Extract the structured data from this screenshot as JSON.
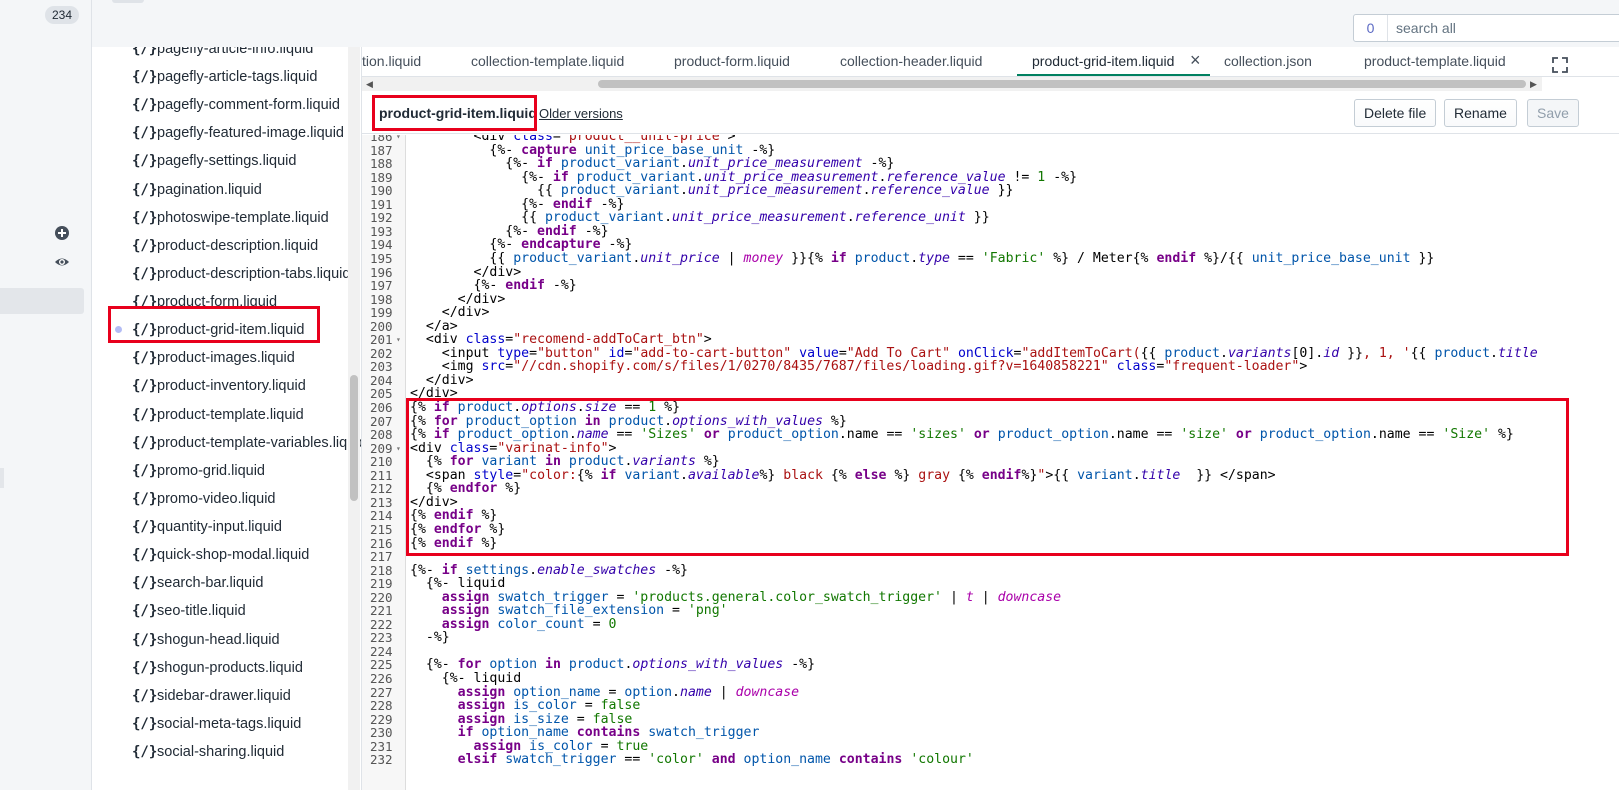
{
  "nav": {
    "badge": "234"
  },
  "search": {
    "count": "0",
    "placeholder": "search all"
  },
  "files": [
    {
      "icon": "{/}",
      "name": "pagefly-article-info.liquid"
    },
    {
      "icon": "{/}",
      "name": "pagefly-article-tags.liquid"
    },
    {
      "icon": "{/}",
      "name": "pagefly-comment-form.liquid"
    },
    {
      "icon": "{/}",
      "name": "pagefly-featured-image.liquid"
    },
    {
      "icon": "{/}",
      "name": "pagefly-settings.liquid"
    },
    {
      "icon": "{/}",
      "name": "pagination.liquid"
    },
    {
      "icon": "{/}",
      "name": "photoswipe-template.liquid"
    },
    {
      "icon": "{/}",
      "name": "product-description.liquid"
    },
    {
      "icon": "{/}",
      "name": "product-description-tabs.liquid"
    },
    {
      "icon": "{/}",
      "name": "product-form.liquid"
    },
    {
      "icon": "{/}",
      "name": "product-grid-item.liquid"
    },
    {
      "icon": "{/}",
      "name": "product-images.liquid"
    },
    {
      "icon": "{/}",
      "name": "product-inventory.liquid"
    },
    {
      "icon": "{/}",
      "name": "product-template.liquid"
    },
    {
      "icon": "{/}",
      "name": "product-template-variables.liquid"
    },
    {
      "icon": "{/}",
      "name": "promo-grid.liquid"
    },
    {
      "icon": "{/}",
      "name": "promo-video.liquid"
    },
    {
      "icon": "{/}",
      "name": "quantity-input.liquid"
    },
    {
      "icon": "{/}",
      "name": "quick-shop-modal.liquid"
    },
    {
      "icon": "{/}",
      "name": "search-bar.liquid"
    },
    {
      "icon": "{/}",
      "name": "seo-title.liquid"
    },
    {
      "icon": "{/}",
      "name": "shogun-head.liquid"
    },
    {
      "icon": "{/}",
      "name": "shogun-products.liquid"
    },
    {
      "icon": "{/}",
      "name": "sidebar-drawer.liquid"
    },
    {
      "icon": "{/}",
      "name": "social-meta-tags.liquid"
    },
    {
      "icon": "{/}",
      "name": "social-sharing.liquid"
    }
  ],
  "tabs": [
    {
      "label": "tion.liquid"
    },
    {
      "label": "collection-template.liquid"
    },
    {
      "label": "product-form.liquid"
    },
    {
      "label": "collection-header.liquid"
    },
    {
      "label": "product-grid-item.liquid"
    },
    {
      "label": "collection.json"
    },
    {
      "label": "product-template.liquid"
    }
  ],
  "tab_close": "×",
  "editor": {
    "filename": "product-grid-item.liquid",
    "older_versions": "Older versions",
    "delete_label": "Delete file",
    "rename_label": "Rename",
    "save_label": "Save"
  },
  "code_lines": [
    {
      "n": "186",
      "fold": "▾",
      "html": "        &lt;div <span class=\"a\">class</span>=<span class=\"s\">\"product__unit-price\"</span>&gt;"
    },
    {
      "n": "187",
      "fold": "",
      "html": "          {%- <span class=\"k\">capture</span> <span class=\"v\">unit_price_base_unit</span> -%}"
    },
    {
      "n": "188",
      "fold": "",
      "html": "            {%- <span class=\"k\">if</span> <span class=\"v\">product_variant</span>.<span class=\"f\">unit_price_measurement</span> -%}"
    },
    {
      "n": "189",
      "fold": "",
      "html": "              {%- <span class=\"k\">if</span> <span class=\"v\">product_variant</span>.<span class=\"f\">unit_price_measurement</span>.<span class=\"f\">reference_value</span> != <span class=\"t\">1</span> -%}"
    },
    {
      "n": "190",
      "fold": "",
      "html": "                {{ <span class=\"v\">product_variant</span>.<span class=\"f\">unit_price_measurement</span>.<span class=\"f\">reference_value</span> }}"
    },
    {
      "n": "191",
      "fold": "",
      "html": "              {%- <span class=\"k\">endif</span> -%}"
    },
    {
      "n": "192",
      "fold": "",
      "html": "              {{ <span class=\"v\">product_variant</span>.<span class=\"f\">unit_price_measurement</span>.<span class=\"f\">reference_unit</span> }}"
    },
    {
      "n": "193",
      "fold": "",
      "html": "            {%- <span class=\"k\">endif</span> -%}"
    },
    {
      "n": "194",
      "fold": "",
      "html": "          {%- <span class=\"k\">endcapture</span> -%}"
    },
    {
      "n": "195",
      "fold": "",
      "html": "          {{ <span class=\"v\">product_variant</span>.<span class=\"f\">unit_price</span> | <span class=\"f\" style=\"color:#a0a\">money</span> }}{% <span class=\"k\">if</span> <span class=\"v\">product</span>.<span class=\"f\">type</span> == <span class=\"s\" style=\"color:#170\">'Fabric'</span> %} / Meter{% <span class=\"k\">endif</span> %}/{{ <span class=\"v\">unit_price_base_unit</span> }}"
    },
    {
      "n": "196",
      "fold": "",
      "html": "        &lt;/div&gt;"
    },
    {
      "n": "197",
      "fold": "",
      "html": "        {%- <span class=\"k\">endif</span> -%}"
    },
    {
      "n": "198",
      "fold": "",
      "html": "      &lt;/div&gt;"
    },
    {
      "n": "199",
      "fold": "",
      "html": "    &lt;/div&gt;"
    },
    {
      "n": "200",
      "fold": "",
      "html": "  &lt;/a&gt;"
    },
    {
      "n": "201",
      "fold": "▾",
      "html": "  &lt;div <span class=\"a\">class</span>=<span class=\"s\">\"recomend-addToCart_btn\"</span>&gt;"
    },
    {
      "n": "202",
      "fold": "",
      "html": "    &lt;input <span class=\"a\">type</span>=<span class=\"s\">\"button\"</span> <span class=\"a\">id</span>=<span class=\"s\">\"add-to-cart-button\"</span> <span class=\"a\">value</span>=<span class=\"s\">\"Add To Cart\"</span> <span class=\"a\">onClick</span>=<span class=\"s\">\"addItemToCart(</span>{{ <span class=\"v\">product</span>.<span class=\"f\">variants</span>[0].<span class=\"f\">id</span> }}<span class=\"s\">, 1, '</span>{{ <span class=\"v\">product</span>.<span class=\"f\">title</span>"
    },
    {
      "n": "203",
      "fold": "",
      "html": "    &lt;img <span class=\"a\">src</span>=<span class=\"s\">\"//cdn.shopify.com/s/files/1/0270/8435/7687/files/loading.gif?v=1640858221\"</span> <span class=\"a\">class</span>=<span class=\"s\">\"frequent-loader\"</span>&gt;"
    },
    {
      "n": "204",
      "fold": "",
      "html": "  &lt;/div&gt;"
    },
    {
      "n": "205",
      "fold": "",
      "html": "&lt;/div&gt;"
    },
    {
      "n": "206",
      "fold": "",
      "html": "{% <span class=\"k\">if</span> <span class=\"v\">product</span>.<span class=\"f\">options</span>.<span class=\"f\">size</span> == <span class=\"t\">1</span> %}"
    },
    {
      "n": "207",
      "fold": "",
      "html": "{% <span class=\"k\">for</span> <span class=\"v\">product_option</span> <span class=\"k\">in</span> <span class=\"v\">product</span>.<span class=\"f\">options_with_values</span> %}"
    },
    {
      "n": "208",
      "fold": "",
      "html": "{% <span class=\"k\">if</span> <span class=\"v\">product_option</span>.<span class=\"f\">name</span> == <span class=\"t\">'Sizes'</span> <span class=\"k\">or</span> <span class=\"v\">product_option</span>.name == <span class=\"t\">'sizes'</span> <span class=\"k\">or</span> <span class=\"v\">product_option</span>.name == <span class=\"t\">'size'</span> <span class=\"k\">or</span> <span class=\"v\">product_option</span>.name == <span class=\"t\">'Size'</span> %}"
    },
    {
      "n": "209",
      "fold": "▾",
      "html": "&lt;div <span class=\"a\">class</span>=<span class=\"s\">\"varinat-info\"</span>&gt;"
    },
    {
      "n": "210",
      "fold": "",
      "html": "  {% <span class=\"k\">for</span> <span class=\"v\">variant</span> <span class=\"k\">in</span> <span class=\"v\">product</span>.<span class=\"f\">variants</span> %}"
    },
    {
      "n": "211",
      "fold": "",
      "html": "  &lt;span <span class=\"a\">style</span>=<span class=\"s\">\"color:</span>{% <span class=\"k\">if</span> <span class=\"v\">variant</span>.<span class=\"f\">available</span>%}<span class=\"s\"> black </span>{% <span class=\"k\">else</span> %}<span class=\"s\"> gray </span>{% <span class=\"k\">endif</span>%}<span class=\"s\">\"</span>&gt;{{ <span class=\"v\">variant</span>.<span class=\"f\">title</span>  }} &lt;/span&gt;"
    },
    {
      "n": "212",
      "fold": "",
      "html": "  {% <span class=\"k\">endfor</span> %}"
    },
    {
      "n": "213",
      "fold": "",
      "html": "&lt;/div&gt;"
    },
    {
      "n": "214",
      "fold": "",
      "html": "{% <span class=\"k\">endif</span> %}"
    },
    {
      "n": "215",
      "fold": "",
      "html": "{% <span class=\"k\">endfor</span> %}"
    },
    {
      "n": "216",
      "fold": "",
      "html": "{% <span class=\"k\">endif</span> %}"
    },
    {
      "n": "217",
      "fold": "",
      "html": ""
    },
    {
      "n": "218",
      "fold": "",
      "html": "{%- <span class=\"k\">if</span> <span class=\"v\">settings</span>.<span class=\"f\">enable_swatches</span> -%}"
    },
    {
      "n": "219",
      "fold": "",
      "html": "  {%- liquid"
    },
    {
      "n": "220",
      "fold": "",
      "html": "    <span class=\"k\">assign</span> <span class=\"v\">swatch_trigger</span> = <span class=\"t\">'products.general.color_swatch_trigger'</span> | <span class=\"f\" style=\"color:#a0a\">t</span> | <span class=\"f\" style=\"color:#a0a\">downcase</span>"
    },
    {
      "n": "221",
      "fold": "",
      "html": "    <span class=\"k\">assign</span> <span class=\"v\">swatch_file_extension</span> = <span class=\"t\">'png'</span>"
    },
    {
      "n": "222",
      "fold": "",
      "html": "    <span class=\"k\">assign</span> <span class=\"v\">color_count</span> = <span class=\"t\">0</span>"
    },
    {
      "n": "223",
      "fold": "",
      "html": "  -%}"
    },
    {
      "n": "224",
      "fold": "",
      "html": ""
    },
    {
      "n": "225",
      "fold": "",
      "html": "  {%- <span class=\"k\">for</span> <span class=\"v\">option</span> <span class=\"k\">in</span> <span class=\"v\">product</span>.<span class=\"f\">options_with_values</span> -%}"
    },
    {
      "n": "226",
      "fold": "",
      "html": "    {%- liquid"
    },
    {
      "n": "227",
      "fold": "",
      "html": "      <span class=\"k\">assign</span> <span class=\"v\">option_name</span> = <span class=\"v\">option</span>.<span class=\"f\">name</span> | <span class=\"f\" style=\"color:#a0a\">downcase</span>"
    },
    {
      "n": "228",
      "fold": "",
      "html": "      <span class=\"k\">assign</span> <span class=\"v\">is_color</span> = <span class=\"t\">false</span>"
    },
    {
      "n": "229",
      "fold": "",
      "html": "      <span class=\"k\">assign</span> <span class=\"v\">is_size</span> = <span class=\"t\">false</span>"
    },
    {
      "n": "230",
      "fold": "",
      "html": "      <span class=\"k\">if</span> <span class=\"v\">option_name</span> <span class=\"k\">contains</span> <span class=\"v\">swatch_trigger</span>"
    },
    {
      "n": "231",
      "fold": "",
      "html": "        <span class=\"k\">assign</span> <span class=\"v\">is_color</span> = <span class=\"t\">true</span>"
    },
    {
      "n": "232",
      "fold": "",
      "html": "      <span class=\"k\">elsif</span> <span class=\"v\">swatch_trigger</span> == <span class=\"t\">'color'</span> <span class=\"k\">and</span> <span class=\"v\">option_name</span> <span class=\"k\">contains</span> <span class=\"t\">'colour'</span>"
    }
  ]
}
